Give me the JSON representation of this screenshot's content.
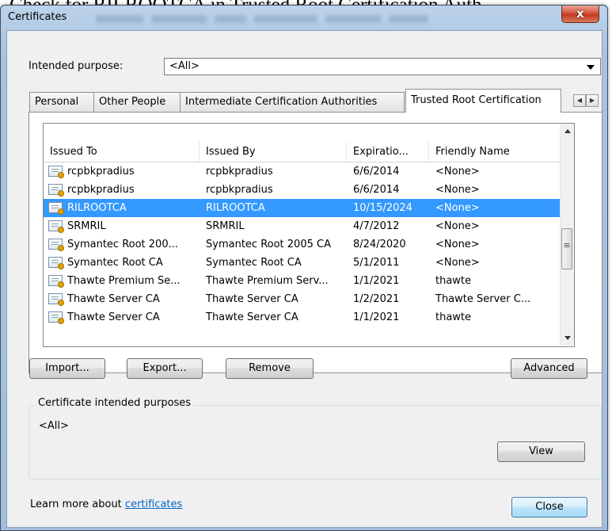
{
  "caption": "Check for RILROOTCA in Trusted Root Certification Auth",
  "window": {
    "title": "Certificates",
    "close_glyph": "x"
  },
  "purpose": {
    "label": "Intended purpose:",
    "value": "<All>"
  },
  "tabs": [
    {
      "label": "Personal"
    },
    {
      "label": "Other People"
    },
    {
      "label": "Intermediate Certification Authorities"
    },
    {
      "label": "Trusted Root Certification"
    }
  ],
  "columns": [
    "Issued To",
    "Issued By",
    "Expiratio...",
    "Friendly Name"
  ],
  "rows": [
    {
      "issued_to": "rcpbkpradius",
      "issued_by": "rcpbkpradius",
      "expiration": "6/6/2014",
      "friendly": "<None>"
    },
    {
      "issued_to": "rcpbkpradius",
      "issued_by": "rcpbkpradius",
      "expiration": "6/6/2014",
      "friendly": "<None>"
    },
    {
      "issued_to": "RILROOTCA",
      "issued_by": "RILROOTCA",
      "expiration": "10/15/2024",
      "friendly": "<None>",
      "selected": true
    },
    {
      "issued_to": "SRMRIL",
      "issued_by": "SRMRIL",
      "expiration": "4/7/2012",
      "friendly": "<None>"
    },
    {
      "issued_to": "Symantec Root 200...",
      "issued_by": "Symantec Root 2005 CA",
      "expiration": "8/24/2020",
      "friendly": "<None>"
    },
    {
      "issued_to": "Symantec Root CA",
      "issued_by": "Symantec Root CA",
      "expiration": "5/1/2011",
      "friendly": "<None>"
    },
    {
      "issued_to": "Thawte Premium Se...",
      "issued_by": "Thawte Premium Serv...",
      "expiration": "1/1/2021",
      "friendly": "thawte"
    },
    {
      "issued_to": "Thawte Server CA",
      "issued_by": "Thawte Server CA",
      "expiration": "1/2/2021",
      "friendly": "Thawte Server C..."
    },
    {
      "issued_to": "Thawte Server CA",
      "issued_by": "Thawte Server CA",
      "expiration": "1/1/2021",
      "friendly": "thawte"
    }
  ],
  "buttons": {
    "import": "Import...",
    "export": "Export...",
    "remove": "Remove",
    "advanced": "Advanced",
    "view": "View",
    "close": "Close"
  },
  "purposes_group": {
    "title": "Certificate intended purposes",
    "value": "<All>"
  },
  "footer": {
    "text": "Learn more about ",
    "link": "certificates"
  },
  "colors": {
    "selection": "#3399ff",
    "link": "#0066cc",
    "titlebar": "#a9c3df"
  }
}
